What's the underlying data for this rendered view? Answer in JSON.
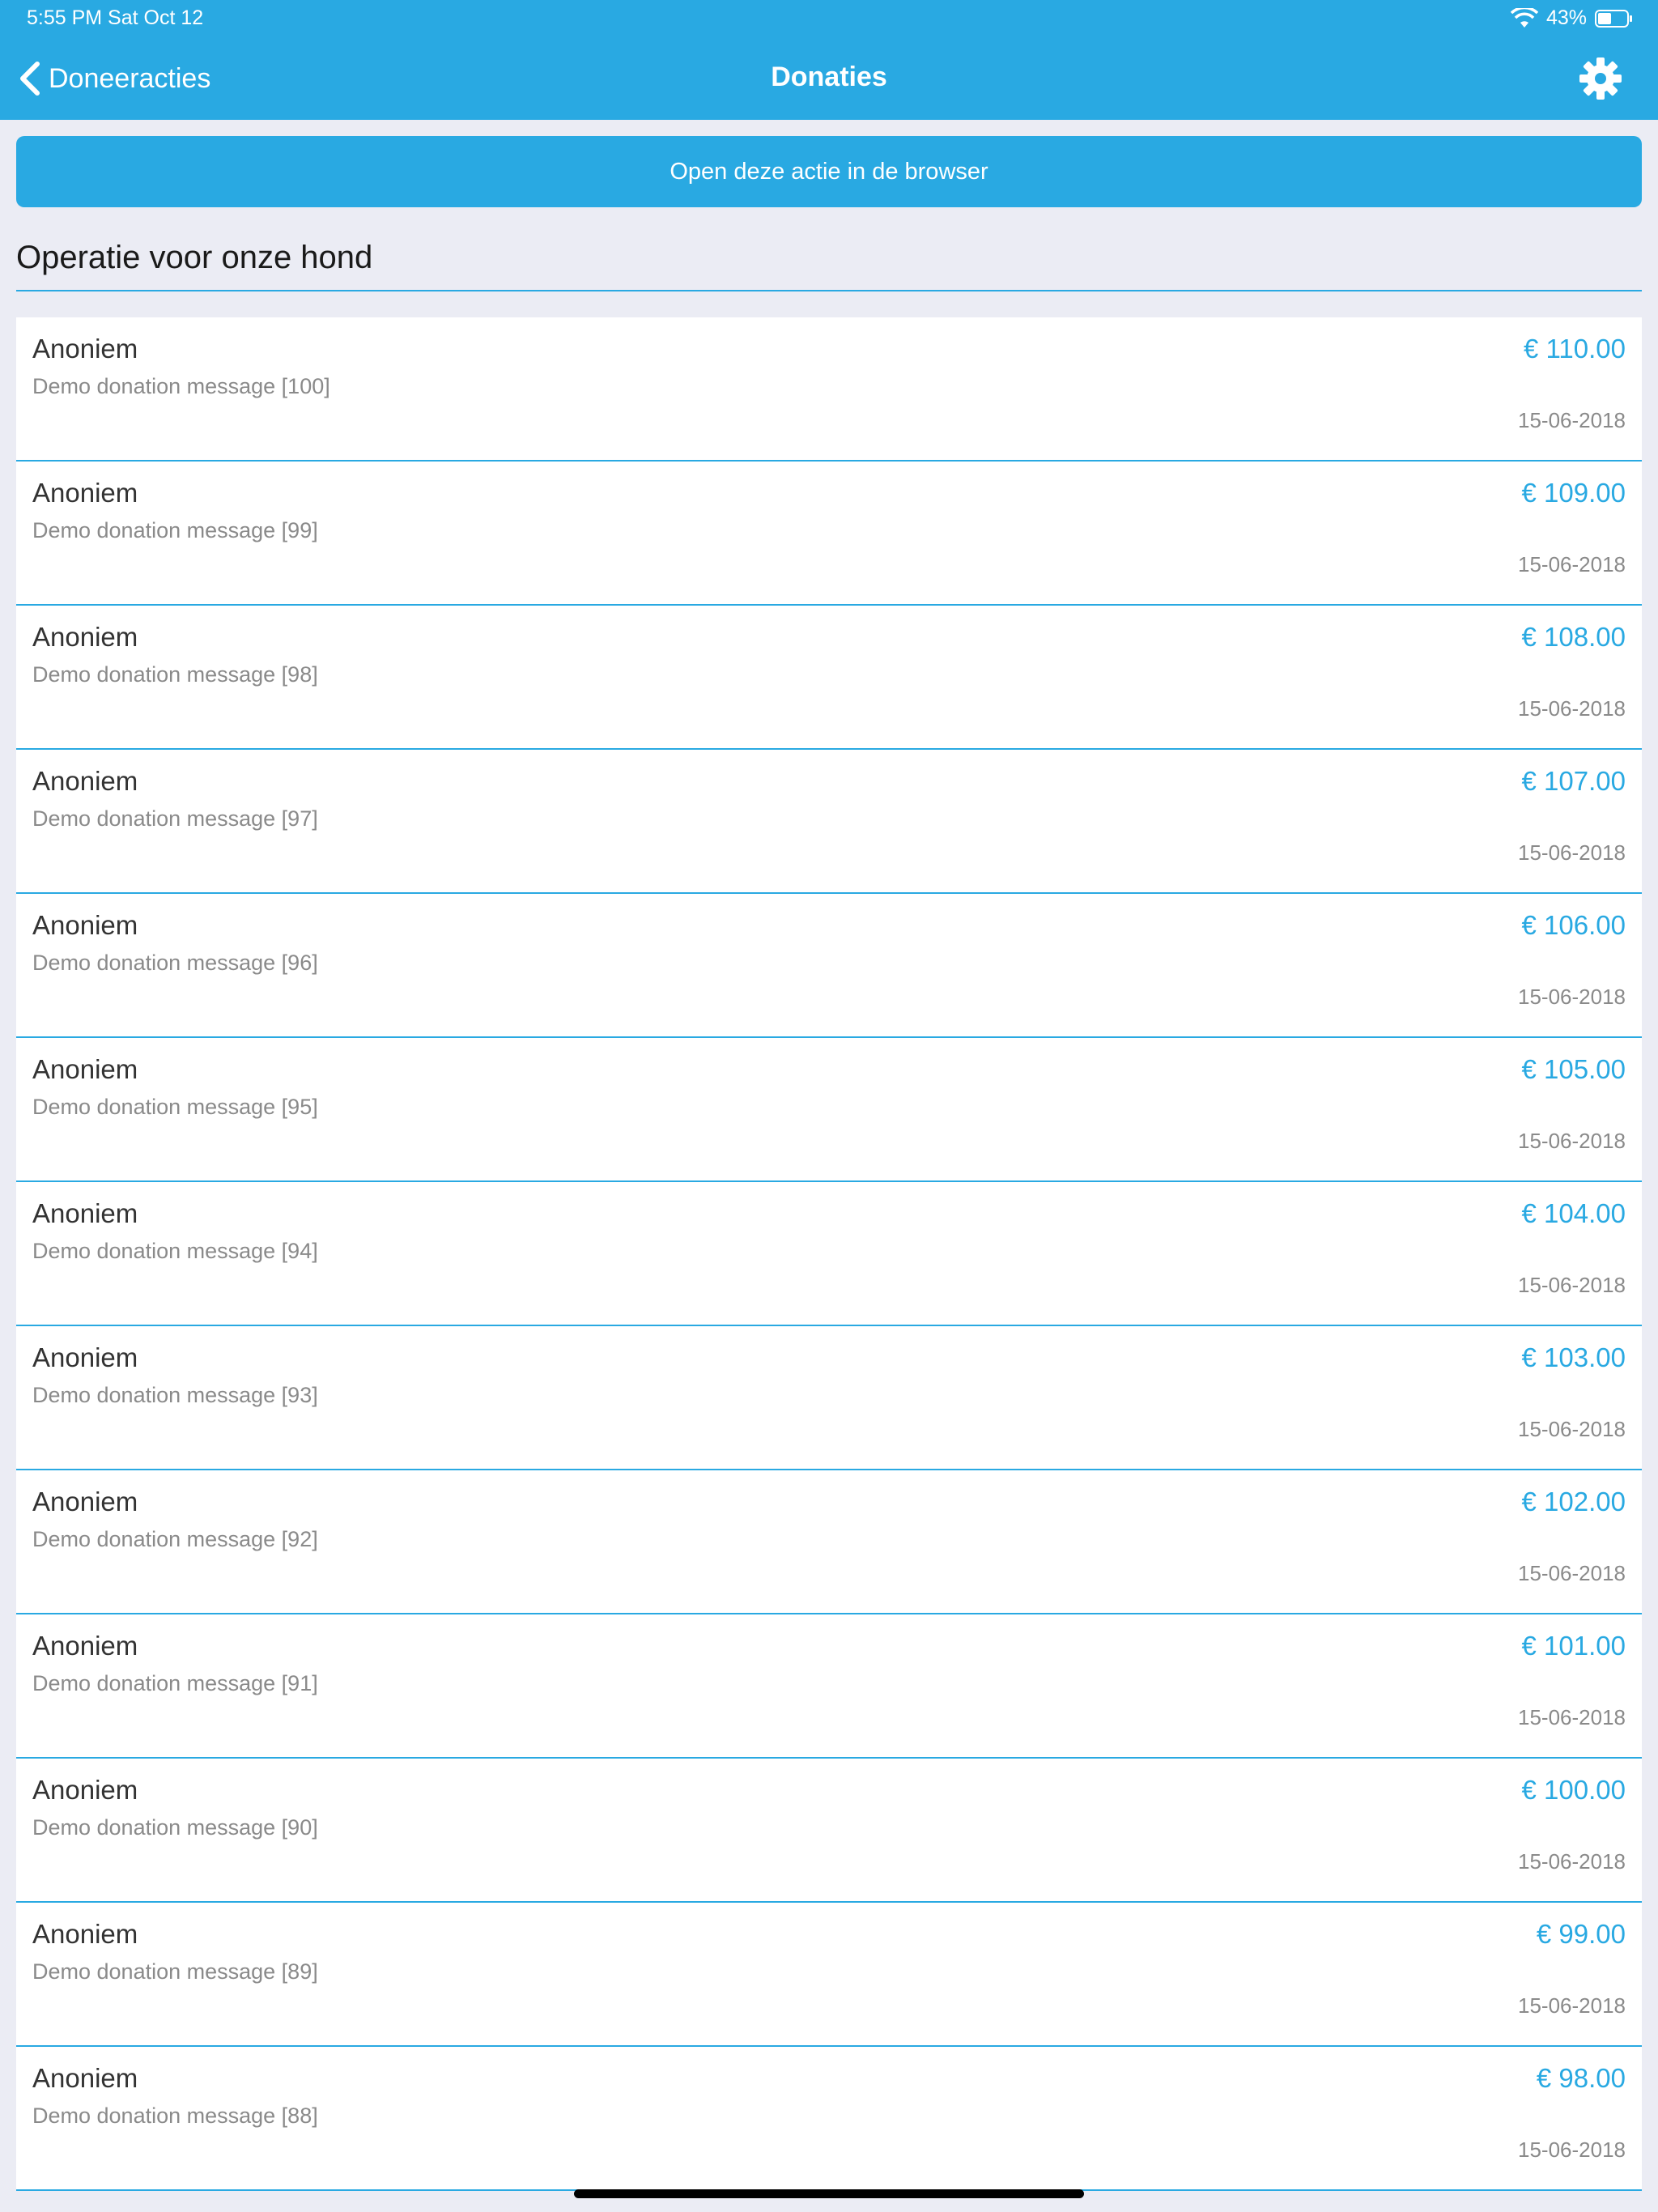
{
  "status_bar": {
    "time_date": "5:55 PM   Sat Oct 12",
    "battery": "43%"
  },
  "nav": {
    "back_label": "Doneeracties",
    "title": "Donaties"
  },
  "open_button_label": "Open deze actie in de browser",
  "section_title": "Operatie voor onze hond",
  "donations": [
    {
      "name": "Anoniem",
      "message": "Demo donation message [100]",
      "amount": "€ 110.00",
      "date": "15-06-2018"
    },
    {
      "name": "Anoniem",
      "message": "Demo donation message [99]",
      "amount": "€ 109.00",
      "date": "15-06-2018"
    },
    {
      "name": "Anoniem",
      "message": "Demo donation message [98]",
      "amount": "€ 108.00",
      "date": "15-06-2018"
    },
    {
      "name": "Anoniem",
      "message": "Demo donation message [97]",
      "amount": "€ 107.00",
      "date": "15-06-2018"
    },
    {
      "name": "Anoniem",
      "message": "Demo donation message [96]",
      "amount": "€ 106.00",
      "date": "15-06-2018"
    },
    {
      "name": "Anoniem",
      "message": "Demo donation message [95]",
      "amount": "€ 105.00",
      "date": "15-06-2018"
    },
    {
      "name": "Anoniem",
      "message": "Demo donation message [94]",
      "amount": "€ 104.00",
      "date": "15-06-2018"
    },
    {
      "name": "Anoniem",
      "message": "Demo donation message [93]",
      "amount": "€ 103.00",
      "date": "15-06-2018"
    },
    {
      "name": "Anoniem",
      "message": "Demo donation message [92]",
      "amount": "€ 102.00",
      "date": "15-06-2018"
    },
    {
      "name": "Anoniem",
      "message": "Demo donation message [91]",
      "amount": "€ 101.00",
      "date": "15-06-2018"
    },
    {
      "name": "Anoniem",
      "message": "Demo donation message [90]",
      "amount": "€ 100.00",
      "date": "15-06-2018"
    },
    {
      "name": "Anoniem",
      "message": "Demo donation message [89]",
      "amount": "€ 99.00",
      "date": "15-06-2018"
    },
    {
      "name": "Anoniem",
      "message": "Demo donation message [88]",
      "amount": "€ 98.00",
      "date": "15-06-2018"
    }
  ],
  "colors": {
    "accent": "#29a9e2",
    "background": "#ebecf4"
  },
  "icons": [
    "chevron-left-icon",
    "gear-icon",
    "wifi-icon",
    "battery-icon"
  ]
}
